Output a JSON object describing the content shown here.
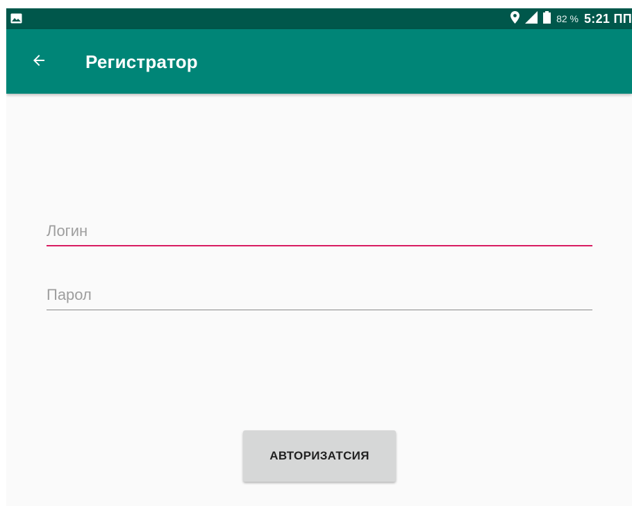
{
  "status_bar": {
    "icons": [
      "gallery-icon",
      "location-icon",
      "signal-icon",
      "battery-icon"
    ],
    "battery_level": "82 %",
    "clock": "5:21 ПП"
  },
  "app_bar": {
    "back_icon": "arrow-left-icon",
    "title": "Регистратор"
  },
  "form": {
    "login": {
      "placeholder": "Логин",
      "value": ""
    },
    "password": {
      "placeholder": "Парол",
      "value": ""
    },
    "submit_label": "АВТОРИЗАТСИЯ"
  },
  "colors": {
    "status_bar": "#00574b",
    "app_bar": "#008577",
    "accent_focus_line": "#d81b60",
    "inactive_line": "#8a8a8a",
    "button_bg": "#d6d7d7"
  }
}
